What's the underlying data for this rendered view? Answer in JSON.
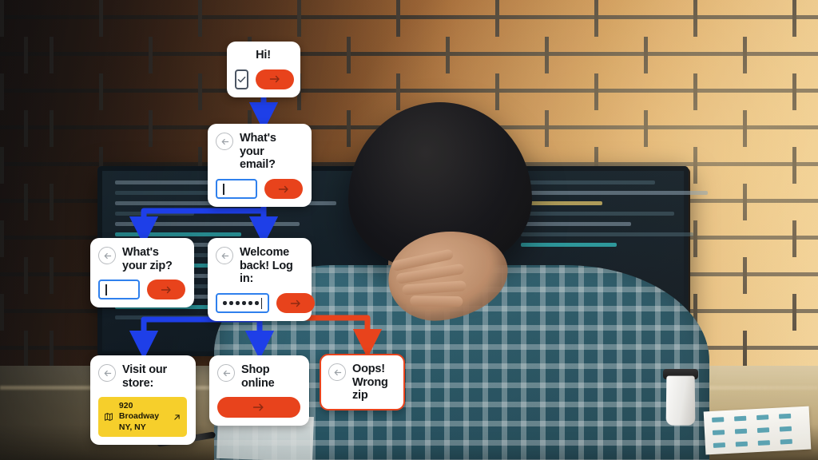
{
  "scene": {
    "description": "Photo of a man seen from behind, hands behind head, sitting at a desk facing monitors against a brick wall, with a conversational-form flowchart overlaid",
    "colors": {
      "accent_orange": "#E8431C",
      "connector_blue": "#1E3FE8",
      "connector_orange": "#E8431C",
      "input_border_blue": "#2F80ED",
      "address_yellow": "#F6CF2B",
      "card_white": "#FFFFFF",
      "text_dark": "#15181C",
      "back_button_gray": "#B9BCC0"
    }
  },
  "flow": {
    "title": "Conversational form flow",
    "cards": [
      {
        "id": "greeting",
        "name": "greeting-card",
        "title": "Hi!",
        "title_align": "center",
        "has_back": false,
        "controls": [
          "checkbox",
          "submit-button"
        ],
        "checkbox_checked": true,
        "submit_icon": "arrow-right-icon"
      },
      {
        "id": "email",
        "name": "email-card",
        "title": "What's your email?",
        "has_back": true,
        "back_icon": "arrow-left-circle-icon",
        "input": {
          "type": "text",
          "value": "",
          "placeholder": "",
          "caret": true
        },
        "submit_icon": "arrow-right-icon"
      },
      {
        "id": "zip",
        "name": "zip-card",
        "title": "What's your zip?",
        "has_back": true,
        "back_icon": "arrow-left-circle-icon",
        "input": {
          "type": "text",
          "value": "",
          "placeholder": "",
          "caret": true
        },
        "submit_icon": "arrow-right-icon"
      },
      {
        "id": "login",
        "name": "login-card",
        "title": "Welcome back! Log in:",
        "has_back": true,
        "back_icon": "arrow-left-circle-icon",
        "input": {
          "type": "password",
          "value": "••••••",
          "dot_count": 6,
          "caret": true
        },
        "submit_icon": "arrow-right-icon"
      },
      {
        "id": "store",
        "name": "visit-store-card",
        "title": "Visit our store:",
        "has_back": true,
        "back_icon": "arrow-left-circle-icon",
        "address": {
          "icon": "map-icon",
          "line1": "920 Broadway",
          "line2": "NY, NY",
          "open_icon": "arrow-up-right-icon"
        }
      },
      {
        "id": "shop",
        "name": "shop-online-card",
        "title": "Shop online",
        "has_back": true,
        "back_icon": "arrow-left-circle-icon",
        "submit_icon": "arrow-right-icon"
      },
      {
        "id": "error",
        "name": "wrong-zip-card",
        "title": "Oops! Wrong zip",
        "has_back": true,
        "back_icon": "arrow-left-circle-icon",
        "variant": "error"
      }
    ],
    "connectors": [
      {
        "from": "greeting",
        "to": "email",
        "color": "blue"
      },
      {
        "from": "email",
        "to": "zip",
        "color": "blue"
      },
      {
        "from": "email",
        "to": "login",
        "color": "blue"
      },
      {
        "from": "login",
        "to": "store",
        "color": "blue"
      },
      {
        "from": "login",
        "to": "shop",
        "color": "blue"
      },
      {
        "from": "login",
        "to": "error",
        "color": "orange"
      }
    ]
  }
}
